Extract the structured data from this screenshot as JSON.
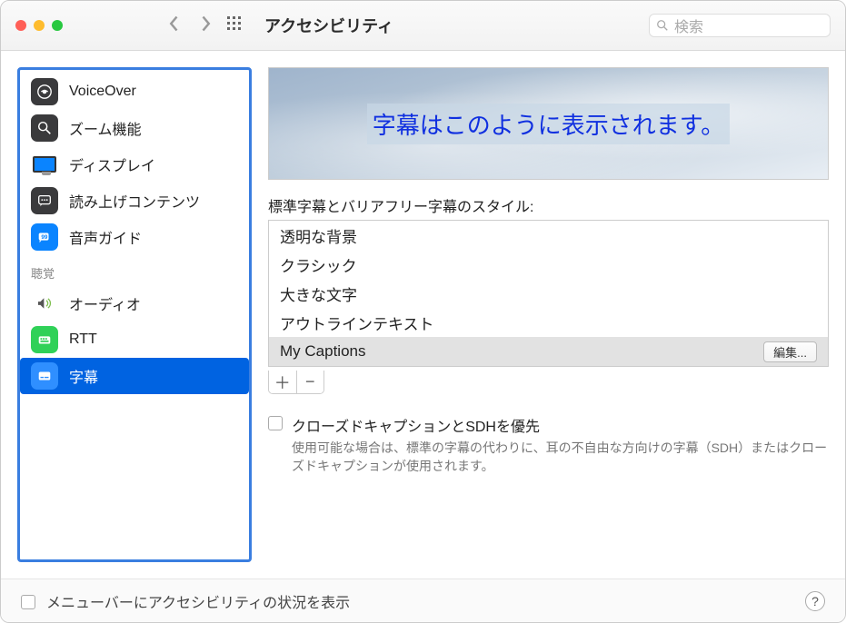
{
  "header": {
    "title": "アクセシビリティ",
    "search_placeholder": "検索"
  },
  "sidebar": {
    "items": [
      {
        "label": "VoiceOver"
      },
      {
        "label": "ズーム機能"
      },
      {
        "label": "ディスプレイ"
      },
      {
        "label": "読み上げコンテンツ"
      },
      {
        "label": "音声ガイド"
      }
    ],
    "hearing_label": "聴覚",
    "hearing_items": [
      {
        "label": "オーディオ"
      },
      {
        "label": "RTT"
      },
      {
        "label": "字幕"
      }
    ]
  },
  "main": {
    "preview_text": "字幕はこのように表示されます。",
    "styles_label": "標準字幕とバリアフリー字幕のスタイル:",
    "styles": [
      {
        "label": "透明な背景"
      },
      {
        "label": "クラシック"
      },
      {
        "label": "大きな文字"
      },
      {
        "label": "アウトラインテキスト"
      },
      {
        "label": "My Captions",
        "edit": "編集..."
      }
    ],
    "cc_title": "クローズドキャプションとSDHを優先",
    "cc_sub": "使用可能な場合は、標準の字幕の代わりに、耳の不自由な方向けの字幕（SDH）またはクローズドキャプションが使用されます。"
  },
  "footer": {
    "label": "メニューバーにアクセシビリティの状況を表示"
  }
}
